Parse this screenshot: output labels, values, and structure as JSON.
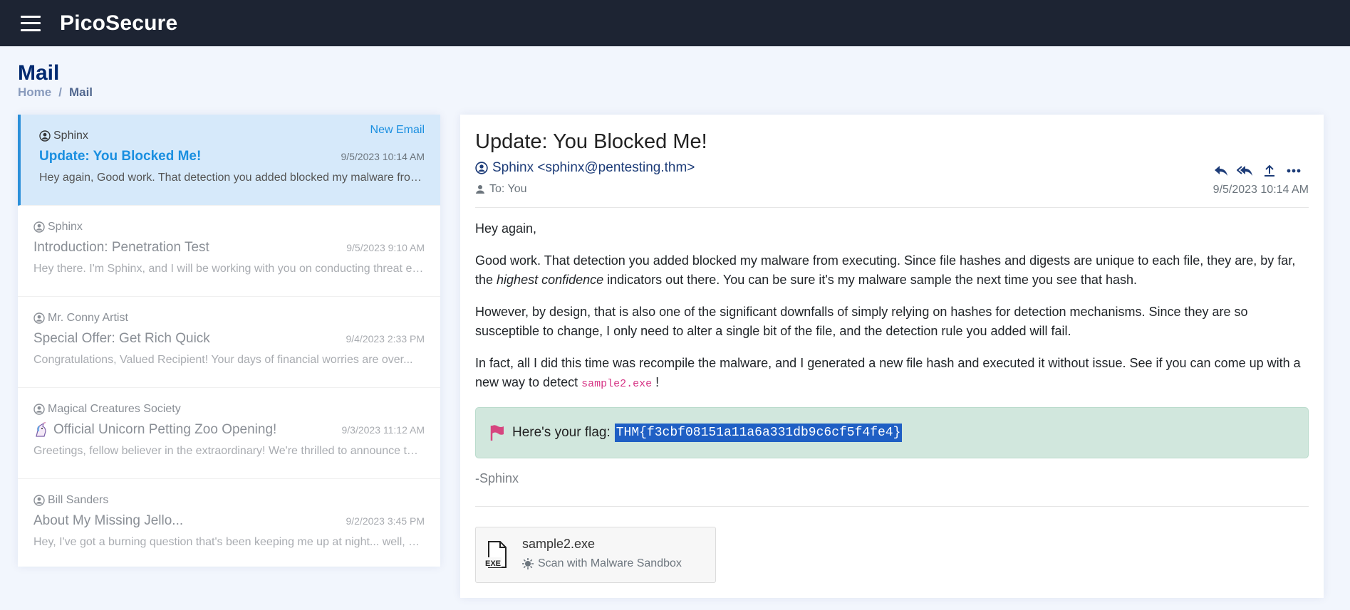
{
  "app": {
    "brand": "PicoSecure"
  },
  "page": {
    "title": "Mail",
    "breadcrumb": [
      "Home",
      "Mail"
    ]
  },
  "mail_list": [
    {
      "from": "Sphinx",
      "subject": "Update: You Blocked Me!",
      "date": "9/5/2023 10:14 AM",
      "preview": "Hey again, Good work. That detection you added blocked my malware from executing. Since file hashes and digests are unique to each file...",
      "badge": "New Email",
      "active": true
    },
    {
      "from": "Sphinx",
      "subject": "Introduction: Penetration Test",
      "date": "9/5/2023 9:10 AM",
      "preview": "Hey there. I'm Sphinx, and I will be working with you on conducting threat emulation during this penetration test..."
    },
    {
      "from": "Mr. Conny Artist",
      "subject": "Special Offer: Get Rich Quick",
      "date": "9/4/2023 2:33 PM",
      "preview": "Congratulations, Valued Recipient! Your days of financial worries are over..."
    },
    {
      "from": "Magical Creatures Society",
      "subject": "Official Unicorn Petting Zoo Opening!",
      "subject_icon": "unicorn-icon",
      "date": "9/3/2023 11:12 AM",
      "preview": "Greetings, fellow believer in the extraordinary! We're thrilled to announce the grand opening..."
    },
    {
      "from": "Bill Sanders",
      "subject": "About My Missing Jello...",
      "date": "9/2/2023 3:45 PM",
      "preview": "Hey, I've got a burning question that's been keeping me up at night... well, more like a wobbly question"
    }
  ],
  "reader": {
    "subject": "Update: You Blocked Me!",
    "from": "Sphinx <sphinx@pentesting.thm>",
    "to": "To: You",
    "date": "9/5/2023 10:14 AM",
    "greeting": "Hey again,",
    "p1_a": "Good work. That detection you added blocked my malware from executing. Since file hashes and digests are unique to each file, they are, by far, the ",
    "p1_em": "highest confidence",
    "p1_b": " indicators out there. You can be sure it's my malware sample the next time you see that hash.",
    "p2": "However, by design, that is also one of the significant downfalls of simply relying on hashes for detection mechanisms. Since they are so susceptible to change, I only need to alter a single bit of the file, and the detection rule you added will fail.",
    "p3_a": "In fact, all I did this time was recompile the malware, and I generated a new file hash and executed it without issue. See if you can come up with a new way to detect ",
    "p3_code": "sample2.exe",
    "p3_b": " !",
    "flag_label": "Here's your flag:",
    "flag_value": "THM{f3cbf08151a11a6a331db9c6cf5f4fe4}",
    "signature": "-Sphinx",
    "attachment": {
      "name": "sample2.exe",
      "type_label": "EXE",
      "action": "Scan with Malware Sandbox"
    }
  },
  "colors": {
    "topbar": "#1d2433",
    "accent": "#1a8fe0",
    "title": "#012970",
    "flag_bg": "#d1e7dd",
    "flag_icon": "#d63384"
  }
}
